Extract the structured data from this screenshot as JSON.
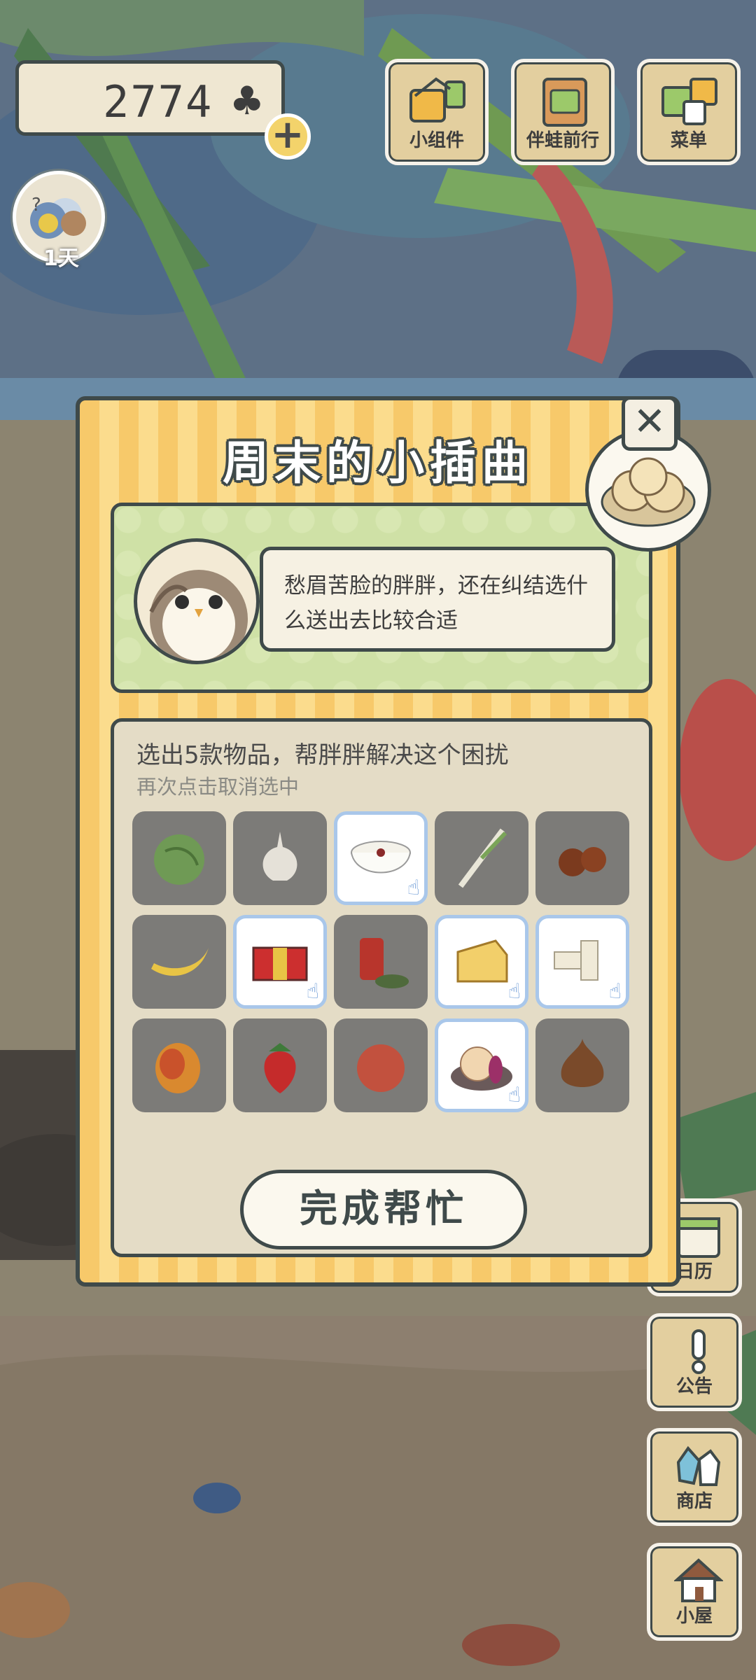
{
  "hud": {
    "clover_count": "2774",
    "clover_symbol": "♣",
    "add_symbol": "+",
    "days_label": "1天"
  },
  "top_buttons": [
    {
      "label": "小组件",
      "icon": "widget-icon"
    },
    {
      "label": "伴蛙前行",
      "icon": "frog-travel-icon"
    },
    {
      "label": "菜单",
      "icon": "menu-cards-icon"
    }
  ],
  "side_buttons": [
    {
      "label": "日历",
      "icon": "calendar-icon"
    },
    {
      "label": "公告",
      "icon": "notice-icon"
    },
    {
      "label": "商店",
      "icon": "shop-icon"
    },
    {
      "label": "小屋",
      "icon": "house-icon"
    }
  ],
  "dialog": {
    "title": "周末的小插曲",
    "close_symbol": "✕",
    "story_text": "愁眉苦脸的胖胖，还在纠结选什么送出去比较合适",
    "instruction": "选出5款物品，帮胖胖解决这个困扰",
    "hint": "再次点击取消选中",
    "done_button": "完成帮忙"
  },
  "items": [
    {
      "name": "cabbage-item",
      "selected": false
    },
    {
      "name": "garlic-item",
      "selected": false
    },
    {
      "name": "porridge-item",
      "selected": true
    },
    {
      "name": "scallion-item",
      "selected": false
    },
    {
      "name": "chestnut-item",
      "selected": false
    },
    {
      "name": "banana-item",
      "selected": false
    },
    {
      "name": "gift-box-item",
      "selected": true
    },
    {
      "name": "tea-can-item",
      "selected": false
    },
    {
      "name": "cheese-item",
      "selected": true
    },
    {
      "name": "nougat-item",
      "selected": true
    },
    {
      "name": "mango-item",
      "selected": false
    },
    {
      "name": "strawberry-item",
      "selected": false
    },
    {
      "name": "peach-item",
      "selected": false
    },
    {
      "name": "flower-cake-item",
      "selected": true
    },
    {
      "name": "onion-item",
      "selected": false
    }
  ],
  "colors": {
    "dialog_stripe_a": "#f7c96a",
    "dialog_stripe_b": "#fbdc8d",
    "outline": "#3f4a4a",
    "story_green": "#cfe1a6",
    "cell_grey": "#7c7b78",
    "selected_border": "#a9c7ea"
  }
}
